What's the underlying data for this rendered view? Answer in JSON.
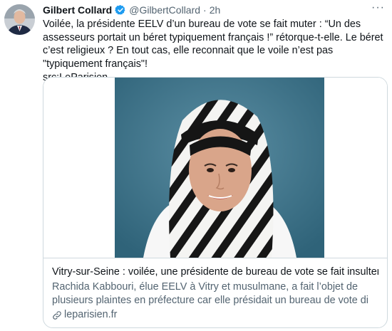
{
  "author": {
    "name": "Gilbert Collard",
    "handle": "@GilbertCollard",
    "separator": "·",
    "time": "2h"
  },
  "more_label": "···",
  "tweet": {
    "text": "Voilée, la présidente EELV d’un bureau de vote se fait muter : “Un des assesseurs portait un béret typiquement français !” rétorque-t-elle. Le béret c’est religieux ? En tout cas, elle reconnait que le voile n’est pas \"typiquement français\"!\nsrc:LeParisien"
  },
  "card": {
    "title": "Vitry-sur-Seine : voilée, une présidente de bureau de vote se fait insulter pui…",
    "description": "Rachida Kabbouri, élue EELV à Vitry et musulmane, a fait l’objet de plusieurs plaintes en préfecture car elle présidait un bureau de vote di",
    "domain": "leparisien.fr"
  },
  "colors": {
    "verified": "#1d9bf0",
    "secondary_text": "#536471",
    "border": "#cfd9de",
    "photo_background": "#3b6f87"
  }
}
